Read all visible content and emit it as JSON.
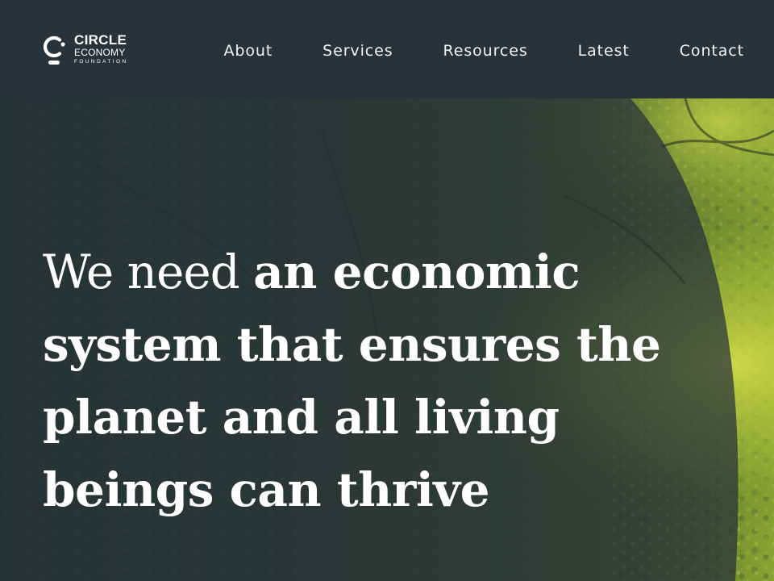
{
  "brand": {
    "line1": "CIRCLE",
    "line2": "ECONOMY",
    "line3": "FOUNDATION"
  },
  "nav": {
    "items": [
      {
        "label": "About"
      },
      {
        "label": "Services"
      },
      {
        "label": "Resources"
      },
      {
        "label": "Latest"
      },
      {
        "label": "Contact"
      }
    ]
  },
  "hero": {
    "heading_light": "We need ",
    "heading_bold": "an economic system that ensures the planet and all living beings can thrive"
  },
  "colors": {
    "header_bg": "#27323b",
    "text": "#ffffff",
    "overlay": "#26313a",
    "foliage_highlight": "#b7c93a"
  },
  "icons": {
    "logo": "circle-economy-logo-icon"
  }
}
